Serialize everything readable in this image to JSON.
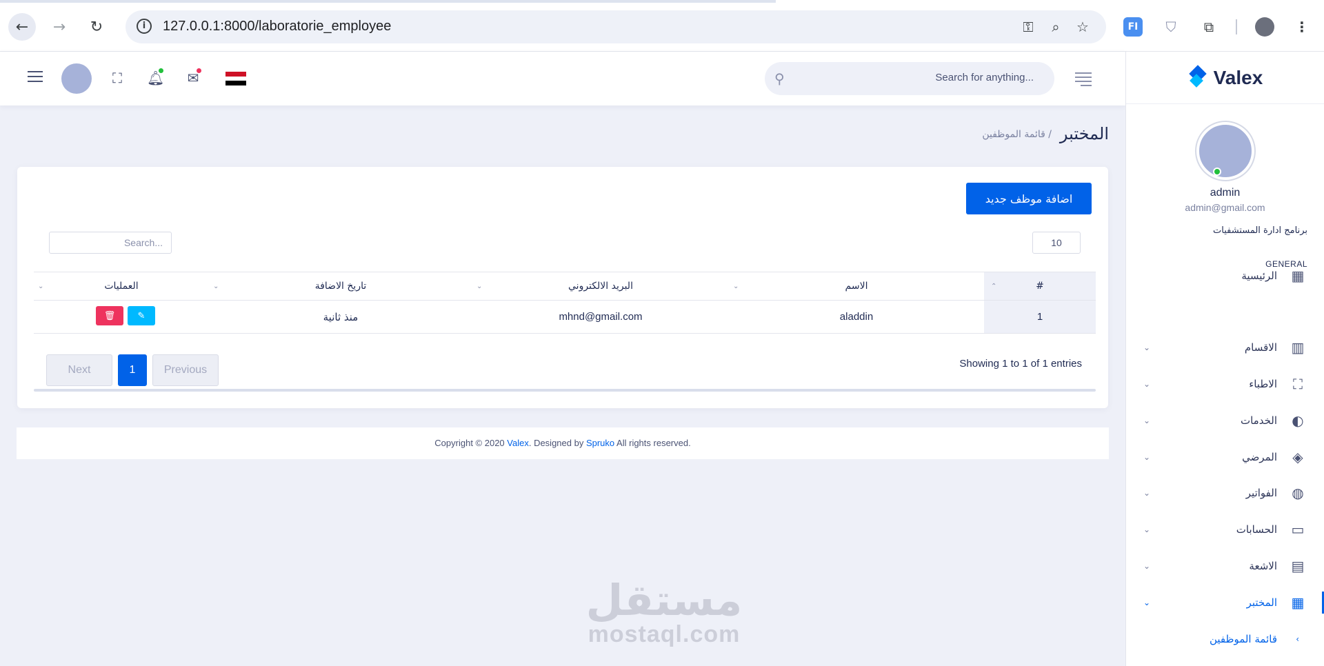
{
  "browser": {
    "url": "127.0.0.1:8000/laboratorie_employee",
    "ext_label": "FI"
  },
  "sidebar": {
    "brand": "Valex",
    "user_name": "admin",
    "user_email": "admin@gmail.com",
    "section_title": "برنامج ادارة المستشفيات",
    "home_label": "الرئيسية",
    "general_label": "GENERAL",
    "items": [
      {
        "label": "الاقسام",
        "icon": "bar-chart-icon"
      },
      {
        "label": "الاطباء",
        "icon": "basket-icon"
      },
      {
        "label": "الخدمات",
        "icon": "pie-icon"
      },
      {
        "label": "المرضي",
        "icon": "layers-icon"
      },
      {
        "label": "الفواتير",
        "icon": "palette-icon"
      },
      {
        "label": "الحسابات",
        "icon": "chat-icon"
      },
      {
        "label": "الاشعة",
        "icon": "document-icon"
      },
      {
        "label": "المختبر",
        "icon": "table-icon"
      }
    ],
    "sub_item": "قائمة الموظفين"
  },
  "header": {
    "search_placeholder": "Search for anything...",
    "colors": {
      "notify_badge": "#22c03c",
      "mail_badge": "#ee335e"
    }
  },
  "page": {
    "title": "المختبر",
    "breadcrumb": "/ قائمة الموظفين"
  },
  "card": {
    "add_button": "اضافة موظف جديد",
    "page_length": "10",
    "search_placeholder": "Search...",
    "columns": {
      "num": "#",
      "name": "الاسم",
      "email": "البريد الالكتروني",
      "date": "تاريخ الاضافة",
      "ops": "العمليات"
    },
    "rows": [
      {
        "num": "1",
        "name": "aladdin",
        "email": "mhnd@gmail.com",
        "date": "منذ ثانية"
      }
    ],
    "info": "Showing 1 to 1 of 1 entries",
    "pager": {
      "next": "Next",
      "current": "1",
      "previous": "Previous"
    }
  },
  "footer": {
    "prefix": "Copyright © 2020 ",
    "brand": "Valex",
    "middle": ". Designed by ",
    "designer": "Spruko",
    "suffix": " All rights reserved."
  },
  "watermark": {
    "arabic": "مستقل",
    "english": "mostaql.com"
  },
  "colors": {
    "primary": "#0162e8",
    "danger": "#ee335e",
    "info": "#00b9ff",
    "background": "#eef0f8"
  }
}
